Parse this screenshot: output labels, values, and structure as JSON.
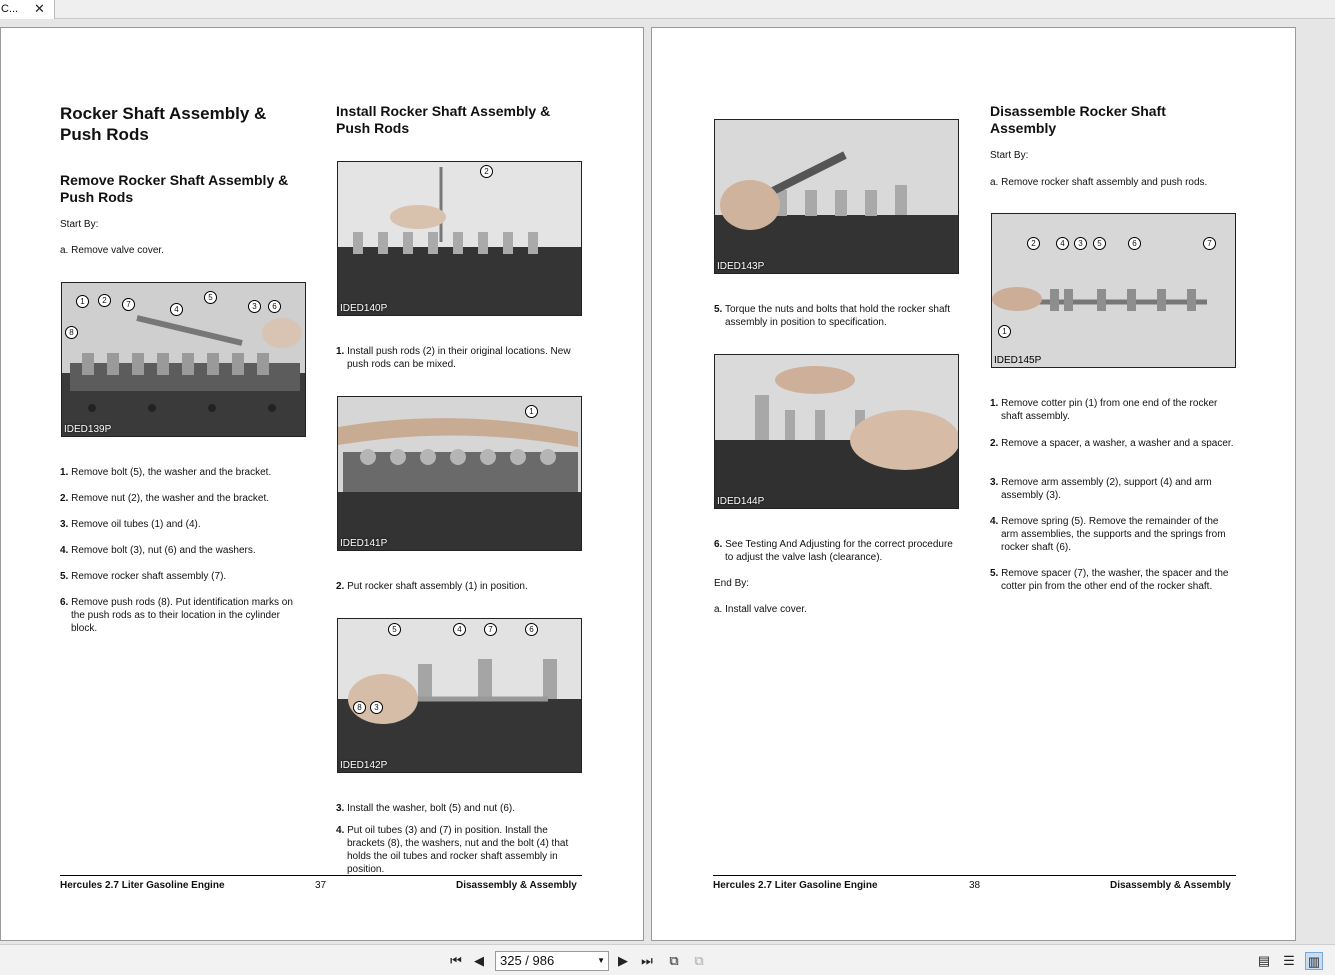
{
  "tab": {
    "title": "C...",
    "close_glyph": "✕"
  },
  "left_page": {
    "col1": {
      "title": "Rocker Shaft Assembly & Push Rods",
      "subtitle": "Remove Rocker Shaft Assembly & Push Rods",
      "start_by": "Start By:",
      "prereq": "a. Remove valve cover.",
      "figure_id": "IDED139P",
      "callouts": [
        "1",
        "2",
        "7",
        "4",
        "5",
        "3",
        "6",
        "8"
      ],
      "steps": [
        {
          "n": "1.",
          "text": "Remove bolt (5), the washer and the bracket."
        },
        {
          "n": "2.",
          "text": "Remove nut (2), the washer and the bracket."
        },
        {
          "n": "3.",
          "text": "Remove oil tubes (1) and (4)."
        },
        {
          "n": "4.",
          "text": "Remove bolt (3), nut (6) and the washers."
        },
        {
          "n": "5.",
          "text": "Remove rocker shaft assembly (7)."
        },
        {
          "n": "6.",
          "text": "Remove push rods (8). Put identification marks on the push rods as to their location in the cylinder block."
        }
      ]
    },
    "col2": {
      "title": "Install Rocker Shaft Assembly & Push Rods",
      "fig1_id": "IDED140P",
      "fig1_callout": "2",
      "step1": {
        "n": "1.",
        "text": "Install push rods (2) in their original locations. New push rods can be mixed."
      },
      "fig2_id": "IDED141P",
      "fig2_callout": "1",
      "step2": {
        "n": "2.",
        "text": "Put rocker shaft assembly (1) in position."
      },
      "fig3_id": "IDED142P",
      "fig3_callouts": [
        "5",
        "4",
        "7",
        "6",
        "8",
        "3"
      ],
      "step3": {
        "n": "3.",
        "text": "Install the washer, bolt (5) and nut (6)."
      },
      "step4": {
        "n": "4.",
        "text": "Put oil tubes (3) and (7) in position. Install the brackets (8), the washers, nut and the bolt (4) that holds the oil tubes and rocker shaft assembly in position."
      }
    },
    "footer": {
      "left": "Hercules 2.7 Liter Gasoline Engine",
      "num": "37",
      "right": "Disassembly & Assembly"
    }
  },
  "right_page": {
    "col1": {
      "fig1_id": "IDED143P",
      "step5": {
        "n": "5.",
        "text": "Torque the nuts and bolts that hold the rocker shaft assembly in position to specification."
      },
      "fig2_id": "IDED144P",
      "step6": {
        "n": "6.",
        "text": "See Testing And Adjusting for the correct procedure to adjust the valve lash (clearance)."
      },
      "end_by": "End By:",
      "post": "a. Install valve cover."
    },
    "col2": {
      "title": "Disassemble Rocker Shaft Assembly",
      "start_by": "Start By:",
      "prereq": "a. Remove rocker shaft assembly and push rods.",
      "figure_id": "IDED145P",
      "callouts": [
        "2",
        "4",
        "3",
        "5",
        "6",
        "7",
        "1"
      ],
      "steps": [
        {
          "n": "1.",
          "text": "Remove cotter pin (1) from one end of the rocker shaft assembly."
        },
        {
          "n": "2.",
          "text": "Remove a spacer, a washer, a washer and a spacer."
        },
        {
          "n": "3.",
          "text": "Remove arm assembly (2), support (4) and arm assembly (3)."
        },
        {
          "n": "4.",
          "text": "Remove spring (5). Remove the remainder of the arm assemblies, the supports and the springs from rocker shaft (6)."
        },
        {
          "n": "5.",
          "text": "Remove spacer (7), the washer, the spacer and the cotter pin from the other end of the rocker shaft."
        }
      ]
    },
    "footer": {
      "left": "Hercules 2.7 Liter Gasoline Engine",
      "num": "38",
      "right": "Disassembly & Assembly"
    }
  },
  "toolbar": {
    "page_indicator": "325 / 986",
    "icons": [
      "first-page-icon",
      "prev-page-icon",
      "next-page-icon",
      "last-page-icon",
      "rotate-icon",
      "copy-icon",
      "single-page-icon",
      "continuous-icon",
      "two-page-icon"
    ]
  }
}
